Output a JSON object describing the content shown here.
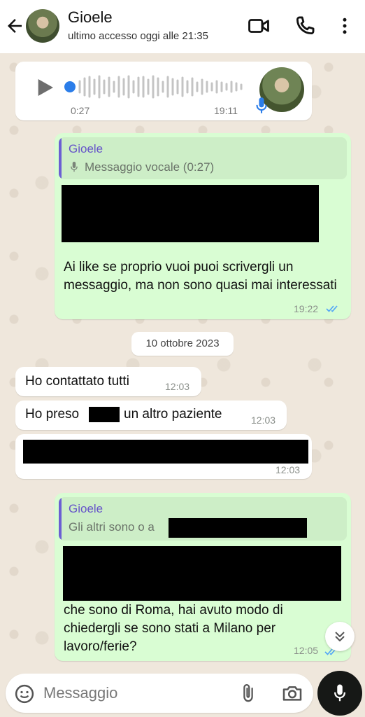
{
  "header": {
    "contact_name": "Gioele",
    "last_seen": "ultimo accesso oggi alle 21:35",
    "icons": [
      "arrow-back-icon",
      "videocam-icon",
      "phone-icon",
      "more-vert-icon"
    ]
  },
  "messages": {
    "voice": {
      "duration": "0:27",
      "time": "19:11"
    },
    "reply1": {
      "quote_author": "Gioele",
      "quote_text": "Messaggio vocale (0:27)",
      "text": "Ai like se proprio vuoi puoi scrivergli un messaggio, ma non sono quasi mai interessati",
      "time": "19:22"
    },
    "date_separator": "10 ottobre 2023",
    "m1": {
      "text": "Ho contattato tutti",
      "time": "12:03"
    },
    "m2": {
      "text_before": "Ho preso",
      "text_after": "un altro paziente",
      "time": "12:03"
    },
    "m3": {
      "time": "12:03"
    },
    "reply2": {
      "quote_author": "Gioele",
      "quote_text": "Gli altri sono o a",
      "text": "che sono di Roma, hai avuto modo di chiedergli se sono stati a Milano per lavoro/ferie?",
      "time": "12:05"
    }
  },
  "composer": {
    "placeholder": "Messaggio"
  },
  "colors": {
    "outgoing_bubble": "#d9fdd3",
    "incoming_bubble": "#ffffff",
    "quote_author": "#6654c9",
    "read_ticks": "#53a6f7",
    "voice_accent": "#2b7de9"
  }
}
